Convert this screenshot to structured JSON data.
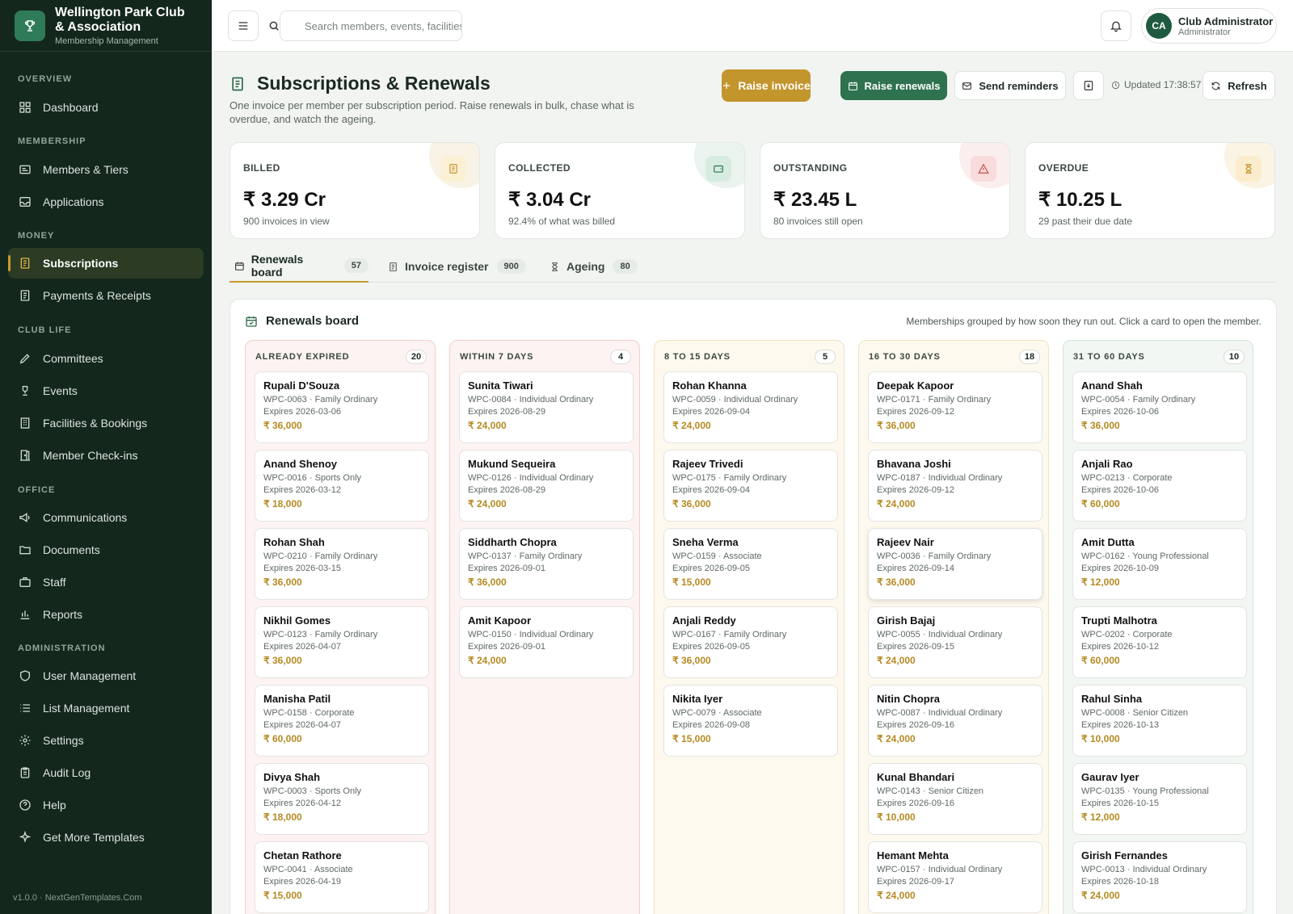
{
  "brand": {
    "title": "Wellington Park Club & Association",
    "subtitle": "Membership Management"
  },
  "nav": {
    "overview": "OVERVIEW",
    "membership": "MEMBERSHIP",
    "money": "MONEY",
    "club_life": "CLUB LIFE",
    "office": "OFFICE",
    "administration": "ADMINISTRATION",
    "items": [
      "Dashboard",
      "Members & Tiers",
      "Applications",
      "Subscriptions",
      "Payments & Receipts",
      "Committees",
      "Events",
      "Facilities & Bookings",
      "Member Check-ins",
      "Communications",
      "Documents",
      "Staff",
      "Reports",
      "User Management",
      "List Management",
      "Settings",
      "Audit Log",
      "Help",
      "Get More Templates"
    ]
  },
  "version": "v1.0.0 · NextGenTemplates.Com",
  "search": {
    "placeholder": "Search members, events, facilities"
  },
  "user": {
    "initials": "CA",
    "name": "Club Administrator",
    "role": "Administrator"
  },
  "page": {
    "title": "Subscriptions & Renewals",
    "description": "One invoice per member per subscription period. Raise renewals in bulk, chase what is overdue, and watch the ageing."
  },
  "actions": {
    "raise_invoice": "Raise invoice",
    "raise_renewals": "Raise renewals",
    "send_reminders": "Send reminders",
    "updated": "Updated 17:38:57",
    "refresh": "Refresh"
  },
  "kpis": [
    {
      "label": "BILLED",
      "value": "₹ 3.29 Cr",
      "sub": "900 invoices in view",
      "icon": "receipt-icon"
    },
    {
      "label": "COLLECTED",
      "value": "₹ 3.04 Cr",
      "sub": "92.4% of what was billed",
      "icon": "wallet-icon"
    },
    {
      "label": "OUTSTANDING",
      "value": "₹ 23.45 L",
      "sub": "80 invoices still open",
      "icon": "alert-icon"
    },
    {
      "label": "OVERDUE",
      "value": "₹ 10.25 L",
      "sub": "29 past their due date",
      "icon": "hourglass-icon"
    }
  ],
  "tabs": [
    {
      "label": "Renewals board",
      "count": "57"
    },
    {
      "label": "Invoice register",
      "count": "900"
    },
    {
      "label": "Ageing",
      "count": "80"
    }
  ],
  "board": {
    "title": "Renewals board",
    "hint": "Memberships grouped by how soon they run out. Click a card to open the member."
  },
  "columns": [
    {
      "title": "ALREADY EXPIRED",
      "count": "20",
      "cards": [
        {
          "name": "Rupali D'Souza",
          "meta": "WPC-0063 · Family Ordinary",
          "expires": "Expires 2026-03-06",
          "amount": "₹ 36,000"
        },
        {
          "name": "Anand Shenoy",
          "meta": "WPC-0016 · Sports Only",
          "expires": "Expires 2026-03-12",
          "amount": "₹ 18,000"
        },
        {
          "name": "Rohan Shah",
          "meta": "WPC-0210 · Family Ordinary",
          "expires": "Expires 2026-03-15",
          "amount": "₹ 36,000"
        },
        {
          "name": "Nikhil Gomes",
          "meta": "WPC-0123 · Family Ordinary",
          "expires": "Expires 2026-04-07",
          "amount": "₹ 36,000"
        },
        {
          "name": "Manisha Patil",
          "meta": "WPC-0158 · Corporate",
          "expires": "Expires 2026-04-07",
          "amount": "₹ 60,000"
        },
        {
          "name": "Divya Shah",
          "meta": "WPC-0003 · Sports Only",
          "expires": "Expires 2026-04-12",
          "amount": "₹ 18,000"
        },
        {
          "name": "Chetan Rathore",
          "meta": "WPC-0041 · Associate",
          "expires": "Expires 2026-04-19",
          "amount": "₹ 15,000"
        }
      ]
    },
    {
      "title": "WITHIN 7 DAYS",
      "count": "4",
      "cards": [
        {
          "name": "Sunita Tiwari",
          "meta": "WPC-0084 · Individual Ordinary",
          "expires": "Expires 2026-08-29",
          "amount": "₹ 24,000"
        },
        {
          "name": "Mukund Sequeira",
          "meta": "WPC-0126 · Individual Ordinary",
          "expires": "Expires 2026-08-29",
          "amount": "₹ 24,000"
        },
        {
          "name": "Siddharth Chopra",
          "meta": "WPC-0137 · Family Ordinary",
          "expires": "Expires 2026-09-01",
          "amount": "₹ 36,000"
        },
        {
          "name": "Amit Kapoor",
          "meta": "WPC-0150 · Individual Ordinary",
          "expires": "Expires 2026-09-01",
          "amount": "₹ 24,000"
        }
      ]
    },
    {
      "title": "8 TO 15 DAYS",
      "count": "5",
      "cards": [
        {
          "name": "Rohan Khanna",
          "meta": "WPC-0059 · Individual Ordinary",
          "expires": "Expires 2026-09-04",
          "amount": "₹ 24,000"
        },
        {
          "name": "Rajeev Trivedi",
          "meta": "WPC-0175 · Family Ordinary",
          "expires": "Expires 2026-09-04",
          "amount": "₹ 36,000"
        },
        {
          "name": "Sneha Verma",
          "meta": "WPC-0159 · Associate",
          "expires": "Expires 2026-09-05",
          "amount": "₹ 15,000"
        },
        {
          "name": "Anjali Reddy",
          "meta": "WPC-0167 · Family Ordinary",
          "expires": "Expires 2026-09-05",
          "amount": "₹ 36,000"
        },
        {
          "name": "Nikita Iyer",
          "meta": "WPC-0079 · Associate",
          "expires": "Expires 2026-09-08",
          "amount": "₹ 15,000"
        }
      ]
    },
    {
      "title": "16 TO 30 DAYS",
      "count": "18",
      "cards": [
        {
          "name": "Deepak Kapoor",
          "meta": "WPC-0171 · Family Ordinary",
          "expires": "Expires 2026-09-12",
          "amount": "₹ 36,000"
        },
        {
          "name": "Bhavana Joshi",
          "meta": "WPC-0187 · Individual Ordinary",
          "expires": "Expires 2026-09-12",
          "amount": "₹ 24,000"
        },
        {
          "name": "Rajeev Nair",
          "meta": "WPC-0036 · Family Ordinary",
          "expires": "Expires 2026-09-14",
          "amount": "₹ 36,000"
        },
        {
          "name": "Girish Bajaj",
          "meta": "WPC-0055 · Individual Ordinary",
          "expires": "Expires 2026-09-15",
          "amount": "₹ 24,000"
        },
        {
          "name": "Nitin Chopra",
          "meta": "WPC-0087 · Individual Ordinary",
          "expires": "Expires 2026-09-16",
          "amount": "₹ 24,000"
        },
        {
          "name": "Kunal Bhandari",
          "meta": "WPC-0143 · Senior Citizen",
          "expires": "Expires 2026-09-16",
          "amount": "₹ 10,000"
        },
        {
          "name": "Hemant Mehta",
          "meta": "WPC-0157 · Individual Ordinary",
          "expires": "Expires 2026-09-17",
          "amount": "₹ 24,000"
        }
      ]
    },
    {
      "title": "31 TO 60 DAYS",
      "count": "10",
      "cards": [
        {
          "name": "Anand Shah",
          "meta": "WPC-0054 · Family Ordinary",
          "expires": "Expires 2026-10-06",
          "amount": "₹ 36,000"
        },
        {
          "name": "Anjali Rao",
          "meta": "WPC-0213 · Corporate",
          "expires": "Expires 2026-10-06",
          "amount": "₹ 60,000"
        },
        {
          "name": "Amit Dutta",
          "meta": "WPC-0162 · Young Professional",
          "expires": "Expires 2026-10-09",
          "amount": "₹ 12,000"
        },
        {
          "name": "Trupti Malhotra",
          "meta": "WPC-0202 · Corporate",
          "expires": "Expires 2026-10-12",
          "amount": "₹ 60,000"
        },
        {
          "name": "Rahul Sinha",
          "meta": "WPC-0008 · Senior Citizen",
          "expires": "Expires 2026-10-13",
          "amount": "₹ 10,000"
        },
        {
          "name": "Gaurav Iyer",
          "meta": "WPC-0135 · Young Professional",
          "expires": "Expires 2026-10-15",
          "amount": "₹ 12,000"
        },
        {
          "name": "Girish Fernandes",
          "meta": "WPC-0013 · Individual Ordinary",
          "expires": "Expires 2026-10-18",
          "amount": "₹ 24,000"
        }
      ]
    }
  ],
  "colors": {
    "sidebar": "#14271d",
    "accent_gold": "#c3952d",
    "accent_green": "#2e7250",
    "amount": "#b58a22"
  }
}
